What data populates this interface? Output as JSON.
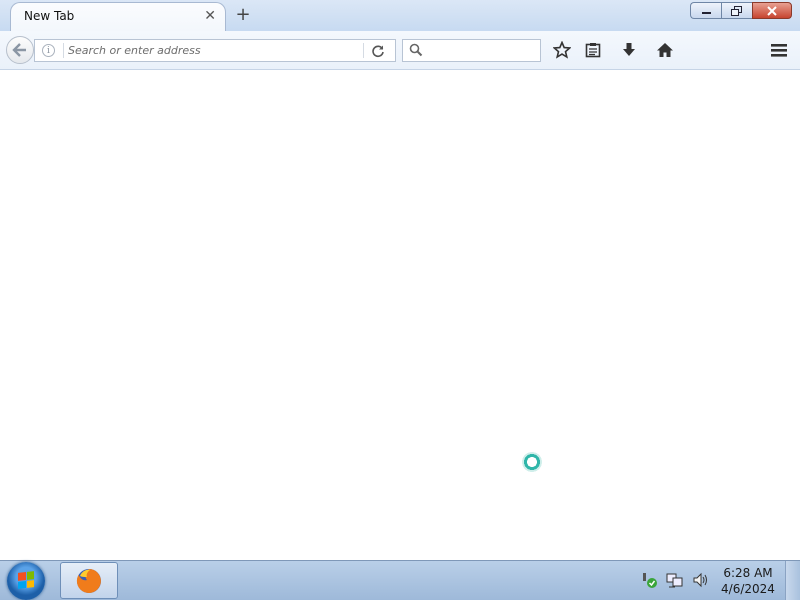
{
  "window": {
    "tab_title": "New Tab",
    "tab_close_icon": "close-icon",
    "new_tab_icon": "plus-icon",
    "controls": [
      "minimize-icon",
      "restore-icon",
      "close-icon"
    ]
  },
  "navbar": {
    "back_icon": "back-arrow-icon",
    "site_info_icon": "info-icon",
    "address_placeholder": "Search or enter address",
    "address_value": "",
    "reload_icon": "reload-icon",
    "search_placeholder": "",
    "toolbar_icons": [
      "star-icon",
      "reading-list-icon",
      "download-icon",
      "home-icon",
      "menu-icon"
    ]
  },
  "content": {
    "loading_icon": "busy-spinner-icon"
  },
  "taskbar": {
    "start_icon": "windows-start-icon",
    "pinned": [
      "firefox-icon"
    ],
    "tray_icons": [
      "action-center-icon",
      "network-icon",
      "volume-icon"
    ],
    "time": "6:28 AM",
    "date": "4/6/2024"
  },
  "colors": {
    "titlebar": "#c7daf1",
    "taskbar": "#a9c2df",
    "close_button": "#c7442f",
    "spinner": "#2fb6a9"
  }
}
